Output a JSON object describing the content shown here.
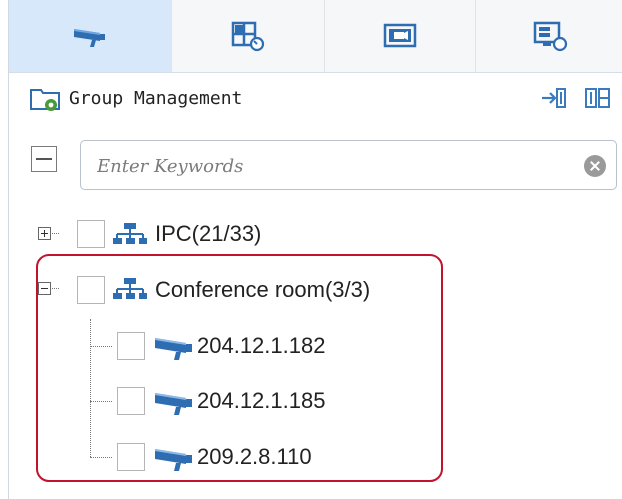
{
  "tabs": [
    {
      "icon": "camera-icon",
      "active": true
    },
    {
      "icon": "view-layout-icon",
      "active": false
    },
    {
      "icon": "video-wall-icon",
      "active": false
    },
    {
      "icon": "screen-refresh-icon",
      "active": false
    }
  ],
  "header": {
    "title": "Group Management",
    "icon": "group-settings-folder-icon",
    "actions": [
      "import-icon",
      "export-icon"
    ]
  },
  "search": {
    "placeholder": "Enter Keywords",
    "value": ""
  },
  "tree": {
    "groups": [
      {
        "label": "IPC(21/33)",
        "expanded": false,
        "checked": false
      },
      {
        "label": "Conference room(3/3)",
        "expanded": true,
        "checked": false,
        "devices": [
          "204.12.1.182",
          "204.12.1.185",
          "209.2.8.110"
        ]
      }
    ]
  },
  "colors": {
    "active_tab": "#d7e8fb",
    "tab_icon_blue": "#2f6db2",
    "highlight": "#c0132d"
  }
}
